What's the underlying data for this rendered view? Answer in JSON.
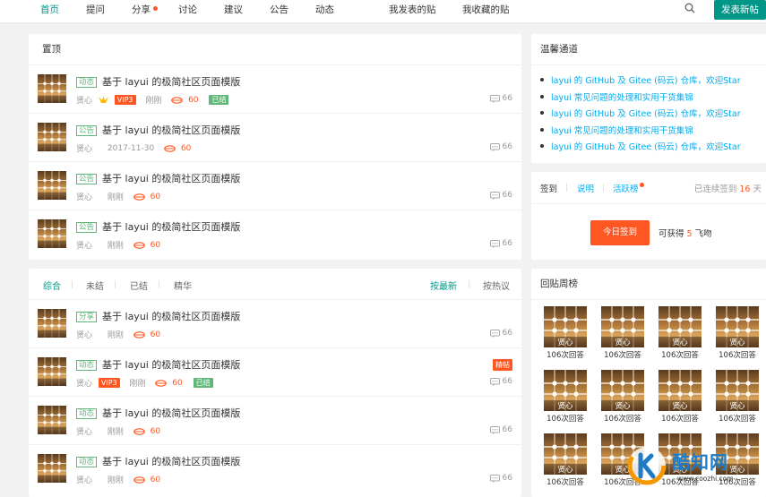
{
  "header": {
    "nav": [
      {
        "label": "首页",
        "active": true
      },
      {
        "label": "提问"
      },
      {
        "label": "分享",
        "dot": true
      },
      {
        "label": "讨论"
      },
      {
        "label": "建议"
      },
      {
        "label": "公告"
      },
      {
        "label": "动态"
      },
      {
        "label": "我发表的贴"
      },
      {
        "label": "我收藏的贴"
      }
    ],
    "search_icon": "search-icon",
    "new_post_label": "发表新帖"
  },
  "pinned": {
    "title": "置顶",
    "posts": [
      {
        "category": "动态",
        "title": "基于 layui 的极简社区页面模版",
        "author": "贤心",
        "crown": true,
        "vip": "VIP3",
        "time": "刚刚",
        "exp": "60",
        "solved": "已结",
        "replies": "66"
      },
      {
        "category": "公告",
        "title": "基于 layui 的极简社区页面模版",
        "author": "贤心",
        "time": "2017-11-30",
        "exp": "60",
        "replies": "66"
      },
      {
        "category": "公告",
        "title": "基于 layui 的极简社区页面模版",
        "author": "贤心",
        "time": "刚刚",
        "exp": "60",
        "replies": "66"
      },
      {
        "category": "公告",
        "title": "基于 layui 的极简社区页面模版",
        "author": "贤心",
        "time": "刚刚",
        "exp": "60",
        "replies": "66"
      }
    ]
  },
  "list": {
    "filters": [
      "综合",
      "未结",
      "已结",
      "精华"
    ],
    "sorts": [
      "按最新",
      "按热议"
    ],
    "posts": [
      {
        "category": "分享",
        "title": "基于 layui 的极简社区页面模版",
        "author": "贤心",
        "time": "刚刚",
        "exp": "60",
        "replies": "66"
      },
      {
        "category": "动态",
        "title": "基于 layui 的极简社区页面模版",
        "author": "贤心",
        "vip": "VIP3",
        "time": "刚刚",
        "exp": "60",
        "solved": "已结",
        "pinned": "精帖",
        "replies": "66"
      },
      {
        "category": "动态",
        "title": "基于 layui 的极简社区页面模版",
        "author": "贤心",
        "time": "刚刚",
        "exp": "60",
        "replies": "66"
      },
      {
        "category": "动态",
        "title": "基于 layui 的极简社区页面模版",
        "author": "贤心",
        "time": "刚刚",
        "exp": "60",
        "replies": "66"
      }
    ]
  },
  "tips": {
    "title": "温馨通道",
    "items": [
      "layui 的 GitHub 及 Gitee (码云) 仓库，欢迎Star",
      "layui 常见问题的处理和实用干货集锦",
      "layui 的 GitHub 及 Gitee (码云) 仓库，欢迎Star",
      "layui 常见问题的处理和实用干货集锦",
      "layui 的 GitHub 及 Gitee (码云) 仓库，欢迎Star"
    ]
  },
  "signin": {
    "tabs": [
      "签到",
      "说明",
      "活跃榜"
    ],
    "streak_prefix": "已连续签到",
    "streak_days": "16",
    "streak_suffix": "天",
    "button_label": "今日签到",
    "reward_prefix": "可获得",
    "reward_amount": "5",
    "reward_suffix": "飞吻"
  },
  "weekly_rank": {
    "title": "回贴周榜",
    "users": [
      {
        "name": "贤心",
        "count": "106次回答"
      },
      {
        "name": "贤心",
        "count": "106次回答"
      },
      {
        "name": "贤心",
        "count": "106次回答"
      },
      {
        "name": "贤心",
        "count": "106次回答"
      },
      {
        "name": "贤心",
        "count": "106次回答"
      },
      {
        "name": "贤心",
        "count": "106次回答"
      },
      {
        "name": "贤心",
        "count": "106次回答"
      },
      {
        "name": "贤心",
        "count": "106次回答"
      },
      {
        "name": "贤心",
        "count": "106次回答"
      },
      {
        "name": "贤心",
        "count": "106次回答"
      },
      {
        "name": "贤心",
        "count": "106次回答"
      },
      {
        "name": "贤心",
        "count": "106次回答"
      }
    ]
  },
  "watermark": {
    "text": "酷知网",
    "url": "www.coozhi.com"
  },
  "colors": {
    "primary": "#009688",
    "accent": "#ff5722",
    "link": "#01aaed",
    "green": "#5fb878"
  }
}
